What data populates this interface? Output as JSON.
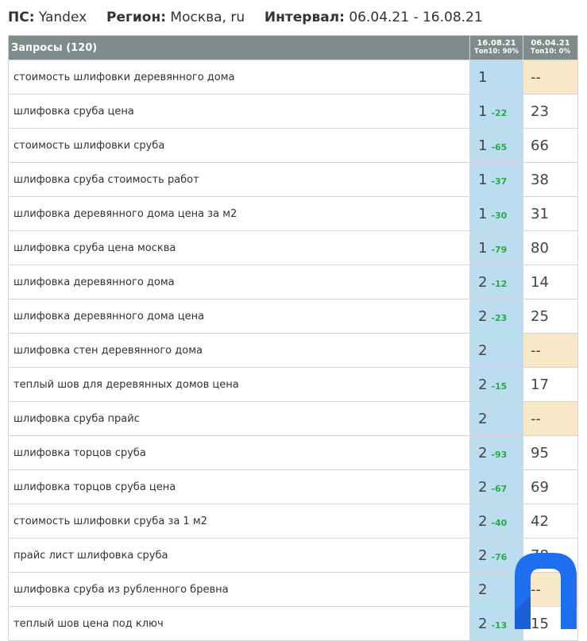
{
  "header": {
    "ps_label": "ПС:",
    "ps_value": "Yandex",
    "region_label": "Регион:",
    "region_value": "Москва, ru",
    "interval_label": "Интервал:",
    "interval_value": "06.04.21 - 16.08.21"
  },
  "table": {
    "queries_header": "Запросы (120)",
    "col1_date": "16.08.21",
    "col1_top": "Топ10: 90%",
    "col2_date": "06.04.21",
    "col2_top": "Топ10: 0%",
    "rows": [
      {
        "query": "стоимость шлифовки деревянного дома",
        "pos": "1",
        "delta": "",
        "old": "--"
      },
      {
        "query": "шлифовка сруба цена",
        "pos": "1",
        "delta": "-22",
        "old": "23"
      },
      {
        "query": "стоимость шлифовки сруба",
        "pos": "1",
        "delta": "-65",
        "old": "66"
      },
      {
        "query": "шлифовка сруба стоимость работ",
        "pos": "1",
        "delta": "-37",
        "old": "38"
      },
      {
        "query": "шлифовка деревянного дома цена за м2",
        "pos": "1",
        "delta": "-30",
        "old": "31"
      },
      {
        "query": "шлифовка сруба цена москва",
        "pos": "1",
        "delta": "-79",
        "old": "80"
      },
      {
        "query": "шлифовка деревянного дома",
        "pos": "2",
        "delta": "-12",
        "old": "14"
      },
      {
        "query": "шлифовка деревянного дома цена",
        "pos": "2",
        "delta": "-23",
        "old": "25"
      },
      {
        "query": "шлифовка стен деревянного дома",
        "pos": "2",
        "delta": "",
        "old": "--"
      },
      {
        "query": "теплый шов для деревянных домов цена",
        "pos": "2",
        "delta": "-15",
        "old": "17"
      },
      {
        "query": "шлифовка сруба прайс",
        "pos": "2",
        "delta": "",
        "old": "--"
      },
      {
        "query": "шлифовка торцов сруба",
        "pos": "2",
        "delta": "-93",
        "old": "95"
      },
      {
        "query": "шлифовка торцов сруба цена",
        "pos": "2",
        "delta": "-67",
        "old": "69"
      },
      {
        "query": "стоимость шлифовки сруба за 1 м2",
        "pos": "2",
        "delta": "-40",
        "old": "42"
      },
      {
        "query": "прайс лист шлифовка сруба",
        "pos": "2",
        "delta": "-76",
        "old": "78"
      },
      {
        "query": "шлифовка сруба из рубленного бревна",
        "pos": "2",
        "delta": "",
        "old": "--"
      },
      {
        "query": "теплый шов цена под ключ",
        "pos": "2",
        "delta": "-13",
        "old": "15"
      }
    ]
  },
  "colors": {
    "header_bg": "#7f8a8a",
    "current_pos_bg": "#bcdcf0",
    "missing_bg": "#f7e9c8",
    "delta_color": "#2aa84a",
    "logo_color": "#1e6ff0"
  },
  "logo": {
    "icon": "brand-logo-icon"
  }
}
